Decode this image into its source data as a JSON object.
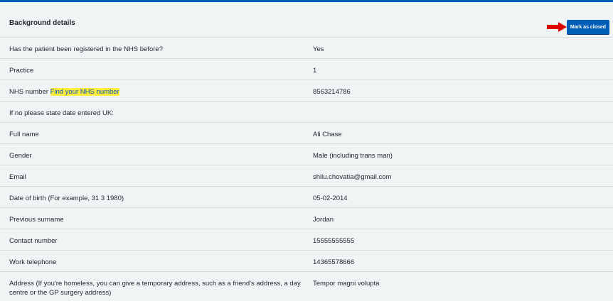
{
  "section": {
    "title": "Background details",
    "mark_closed_label": "Mark as closed"
  },
  "details": [
    {
      "key": "Has the patient been registered in the NHS before?",
      "value": "Yes"
    },
    {
      "key": "Practice",
      "value": "1"
    },
    {
      "key": "NHS number",
      "link": "Find your NHS number",
      "value": "8563214786"
    },
    {
      "key": "If no please state date entered UK:",
      "value": ""
    },
    {
      "key": "Full name",
      "value": "Ali Chase"
    },
    {
      "key": "Gender",
      "value": "Male (including trans man)"
    },
    {
      "key": "Email",
      "value": "shilu.chovatia@gmail.com"
    },
    {
      "key": "Date of birth (For example, 31 3 1980)",
      "value": "05-02-2014"
    },
    {
      "key": "Previous surname",
      "value": "Jordan"
    },
    {
      "key": "Contact number",
      "value": "15555555555"
    },
    {
      "key": "Work telephone",
      "value": "14365578666"
    },
    {
      "key": "Address (If you're homeless, you can give a temporary address, such as a friend's address, a day centre or the GP surgery address)",
      "value": "Tempor magni volupta"
    }
  ],
  "colors": {
    "accent": "#005eb8",
    "highlight": "#ffeb3b",
    "arrow": "#e00000",
    "background": "#f0f4f5"
  },
  "icons": {
    "annotation_arrow": "red-right-arrow-icon"
  }
}
